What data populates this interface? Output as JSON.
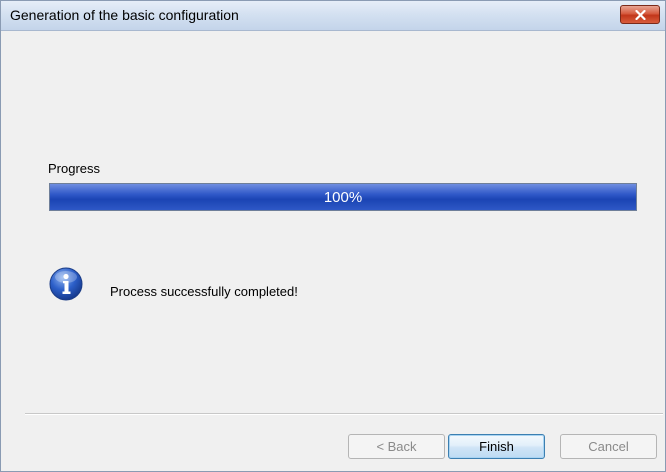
{
  "window": {
    "title": "Generation of the basic configuration"
  },
  "progress": {
    "label": "Progress",
    "value_text": "100%",
    "fraction": 1.0,
    "fill_color": "#1b44b4"
  },
  "message": {
    "icon": "info-icon",
    "text": "Process successfully completed!"
  },
  "buttons": {
    "back": "< Back",
    "finish": "Finish",
    "cancel": "Cancel"
  },
  "icons": {
    "close": "close-icon"
  }
}
